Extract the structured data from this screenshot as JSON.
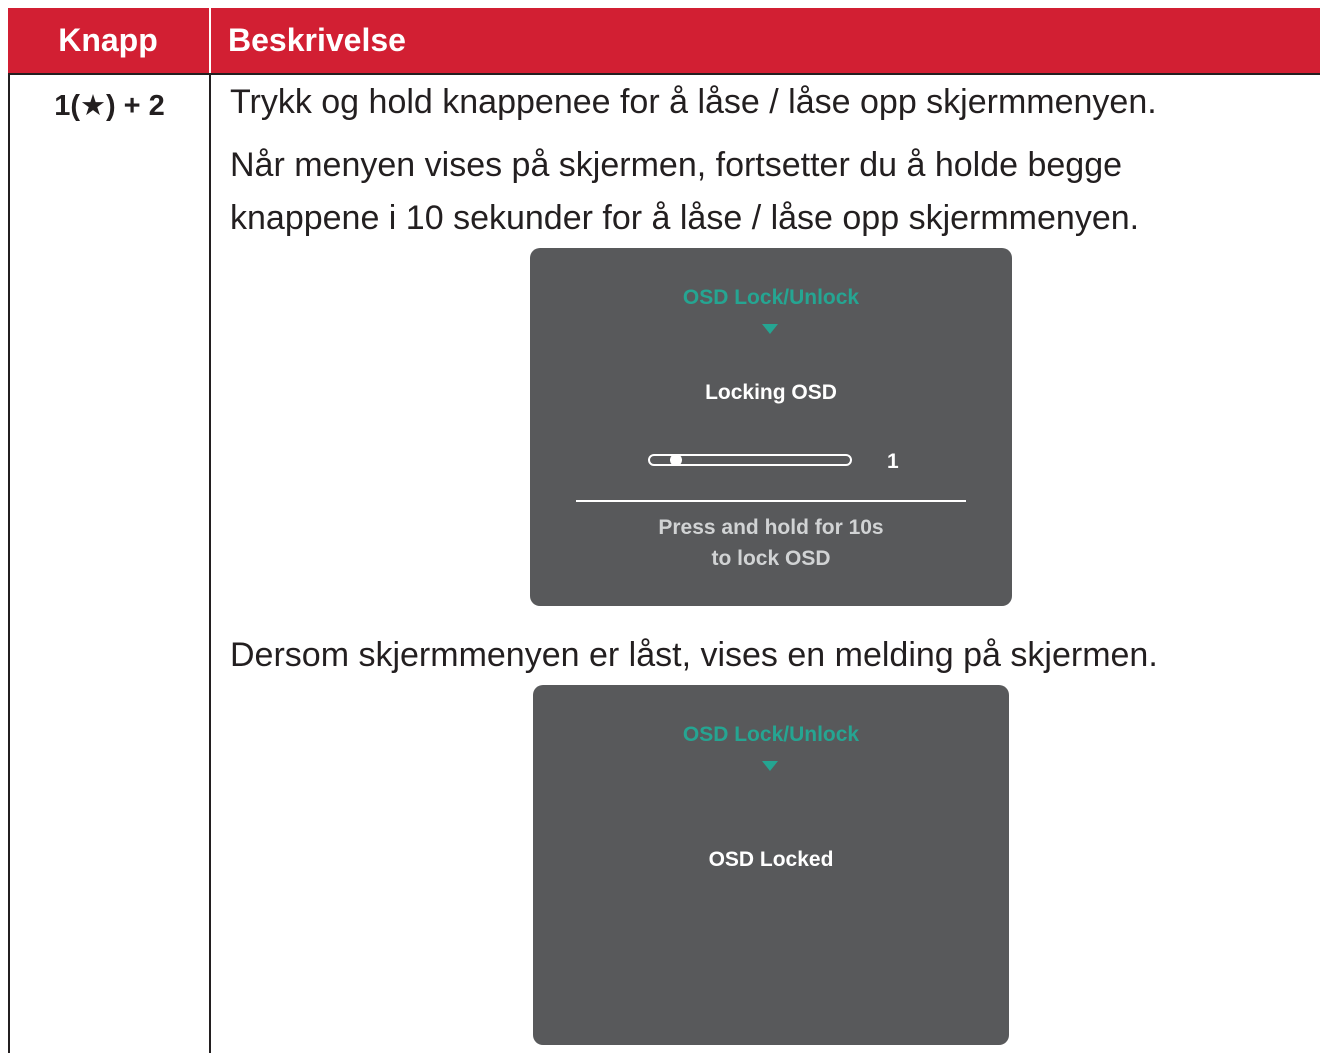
{
  "table": {
    "header": {
      "col_button": "Knapp",
      "col_description": "Beskrivelse"
    },
    "row": {
      "key": "1(★) + 2",
      "lines": [
        "Trykk og hold knappenee for å låse / låse opp skjermmenyen.",
        "Når menyen vises på skjermen, fortsetter du å holde begge",
        "knappene i 10 sekunder for å låse / låse opp skjermmenyen."
      ],
      "locked_note": "Dersom skjermmenyen er låst, vises en melding på skjermen."
    }
  },
  "osd_locking": {
    "title": "OSD Lock/Unlock",
    "status": "Locking OSD",
    "countdown_value": "1",
    "slider_progress": 0.1,
    "hint_line1": "Press and hold for 10s",
    "hint_line2": "to lock OSD"
  },
  "osd_locked": {
    "title": "OSD Lock/Unlock",
    "status": "OSD Locked"
  },
  "colors": {
    "header_bg": "#d21f33",
    "osd_bg": "#58595b",
    "osd_accent": "#25a592"
  }
}
